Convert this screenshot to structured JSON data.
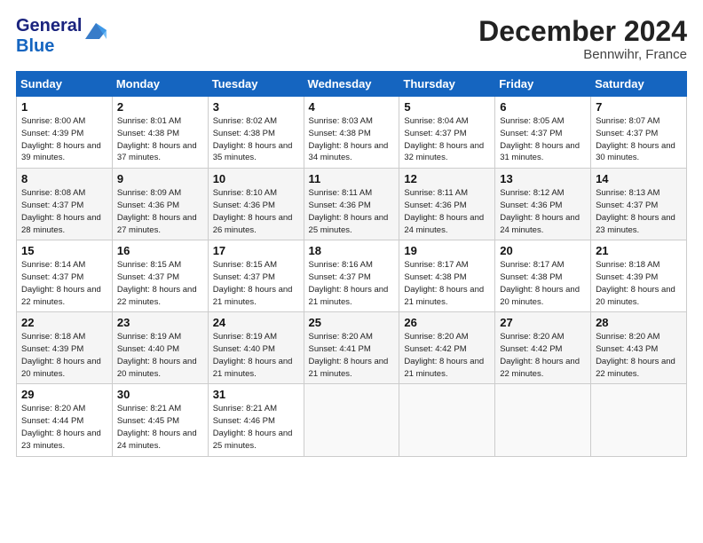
{
  "header": {
    "logo_line1": "General",
    "logo_line2": "Blue",
    "month": "December 2024",
    "location": "Bennwihr, France"
  },
  "weekdays": [
    "Sunday",
    "Monday",
    "Tuesday",
    "Wednesday",
    "Thursday",
    "Friday",
    "Saturday"
  ],
  "weeks": [
    [
      {
        "day": "1",
        "sunrise": "Sunrise: 8:00 AM",
        "sunset": "Sunset: 4:39 PM",
        "daylight": "Daylight: 8 hours and 39 minutes."
      },
      {
        "day": "2",
        "sunrise": "Sunrise: 8:01 AM",
        "sunset": "Sunset: 4:38 PM",
        "daylight": "Daylight: 8 hours and 37 minutes."
      },
      {
        "day": "3",
        "sunrise": "Sunrise: 8:02 AM",
        "sunset": "Sunset: 4:38 PM",
        "daylight": "Daylight: 8 hours and 35 minutes."
      },
      {
        "day": "4",
        "sunrise": "Sunrise: 8:03 AM",
        "sunset": "Sunset: 4:38 PM",
        "daylight": "Daylight: 8 hours and 34 minutes."
      },
      {
        "day": "5",
        "sunrise": "Sunrise: 8:04 AM",
        "sunset": "Sunset: 4:37 PM",
        "daylight": "Daylight: 8 hours and 32 minutes."
      },
      {
        "day": "6",
        "sunrise": "Sunrise: 8:05 AM",
        "sunset": "Sunset: 4:37 PM",
        "daylight": "Daylight: 8 hours and 31 minutes."
      },
      {
        "day": "7",
        "sunrise": "Sunrise: 8:07 AM",
        "sunset": "Sunset: 4:37 PM",
        "daylight": "Daylight: 8 hours and 30 minutes."
      }
    ],
    [
      {
        "day": "8",
        "sunrise": "Sunrise: 8:08 AM",
        "sunset": "Sunset: 4:37 PM",
        "daylight": "Daylight: 8 hours and 28 minutes."
      },
      {
        "day": "9",
        "sunrise": "Sunrise: 8:09 AM",
        "sunset": "Sunset: 4:36 PM",
        "daylight": "Daylight: 8 hours and 27 minutes."
      },
      {
        "day": "10",
        "sunrise": "Sunrise: 8:10 AM",
        "sunset": "Sunset: 4:36 PM",
        "daylight": "Daylight: 8 hours and 26 minutes."
      },
      {
        "day": "11",
        "sunrise": "Sunrise: 8:11 AM",
        "sunset": "Sunset: 4:36 PM",
        "daylight": "Daylight: 8 hours and 25 minutes."
      },
      {
        "day": "12",
        "sunrise": "Sunrise: 8:11 AM",
        "sunset": "Sunset: 4:36 PM",
        "daylight": "Daylight: 8 hours and 24 minutes."
      },
      {
        "day": "13",
        "sunrise": "Sunrise: 8:12 AM",
        "sunset": "Sunset: 4:36 PM",
        "daylight": "Daylight: 8 hours and 24 minutes."
      },
      {
        "day": "14",
        "sunrise": "Sunrise: 8:13 AM",
        "sunset": "Sunset: 4:37 PM",
        "daylight": "Daylight: 8 hours and 23 minutes."
      }
    ],
    [
      {
        "day": "15",
        "sunrise": "Sunrise: 8:14 AM",
        "sunset": "Sunset: 4:37 PM",
        "daylight": "Daylight: 8 hours and 22 minutes."
      },
      {
        "day": "16",
        "sunrise": "Sunrise: 8:15 AM",
        "sunset": "Sunset: 4:37 PM",
        "daylight": "Daylight: 8 hours and 22 minutes."
      },
      {
        "day": "17",
        "sunrise": "Sunrise: 8:15 AM",
        "sunset": "Sunset: 4:37 PM",
        "daylight": "Daylight: 8 hours and 21 minutes."
      },
      {
        "day": "18",
        "sunrise": "Sunrise: 8:16 AM",
        "sunset": "Sunset: 4:37 PM",
        "daylight": "Daylight: 8 hours and 21 minutes."
      },
      {
        "day": "19",
        "sunrise": "Sunrise: 8:17 AM",
        "sunset": "Sunset: 4:38 PM",
        "daylight": "Daylight: 8 hours and 21 minutes."
      },
      {
        "day": "20",
        "sunrise": "Sunrise: 8:17 AM",
        "sunset": "Sunset: 4:38 PM",
        "daylight": "Daylight: 8 hours and 20 minutes."
      },
      {
        "day": "21",
        "sunrise": "Sunrise: 8:18 AM",
        "sunset": "Sunset: 4:39 PM",
        "daylight": "Daylight: 8 hours and 20 minutes."
      }
    ],
    [
      {
        "day": "22",
        "sunrise": "Sunrise: 8:18 AM",
        "sunset": "Sunset: 4:39 PM",
        "daylight": "Daylight: 8 hours and 20 minutes."
      },
      {
        "day": "23",
        "sunrise": "Sunrise: 8:19 AM",
        "sunset": "Sunset: 4:40 PM",
        "daylight": "Daylight: 8 hours and 20 minutes."
      },
      {
        "day": "24",
        "sunrise": "Sunrise: 8:19 AM",
        "sunset": "Sunset: 4:40 PM",
        "daylight": "Daylight: 8 hours and 21 minutes."
      },
      {
        "day": "25",
        "sunrise": "Sunrise: 8:20 AM",
        "sunset": "Sunset: 4:41 PM",
        "daylight": "Daylight: 8 hours and 21 minutes."
      },
      {
        "day": "26",
        "sunrise": "Sunrise: 8:20 AM",
        "sunset": "Sunset: 4:42 PM",
        "daylight": "Daylight: 8 hours and 21 minutes."
      },
      {
        "day": "27",
        "sunrise": "Sunrise: 8:20 AM",
        "sunset": "Sunset: 4:42 PM",
        "daylight": "Daylight: 8 hours and 22 minutes."
      },
      {
        "day": "28",
        "sunrise": "Sunrise: 8:20 AM",
        "sunset": "Sunset: 4:43 PM",
        "daylight": "Daylight: 8 hours and 22 minutes."
      }
    ],
    [
      {
        "day": "29",
        "sunrise": "Sunrise: 8:20 AM",
        "sunset": "Sunset: 4:44 PM",
        "daylight": "Daylight: 8 hours and 23 minutes."
      },
      {
        "day": "30",
        "sunrise": "Sunrise: 8:21 AM",
        "sunset": "Sunset: 4:45 PM",
        "daylight": "Daylight: 8 hours and 24 minutes."
      },
      {
        "day": "31",
        "sunrise": "Sunrise: 8:21 AM",
        "sunset": "Sunset: 4:46 PM",
        "daylight": "Daylight: 8 hours and 25 minutes."
      },
      null,
      null,
      null,
      null
    ]
  ]
}
